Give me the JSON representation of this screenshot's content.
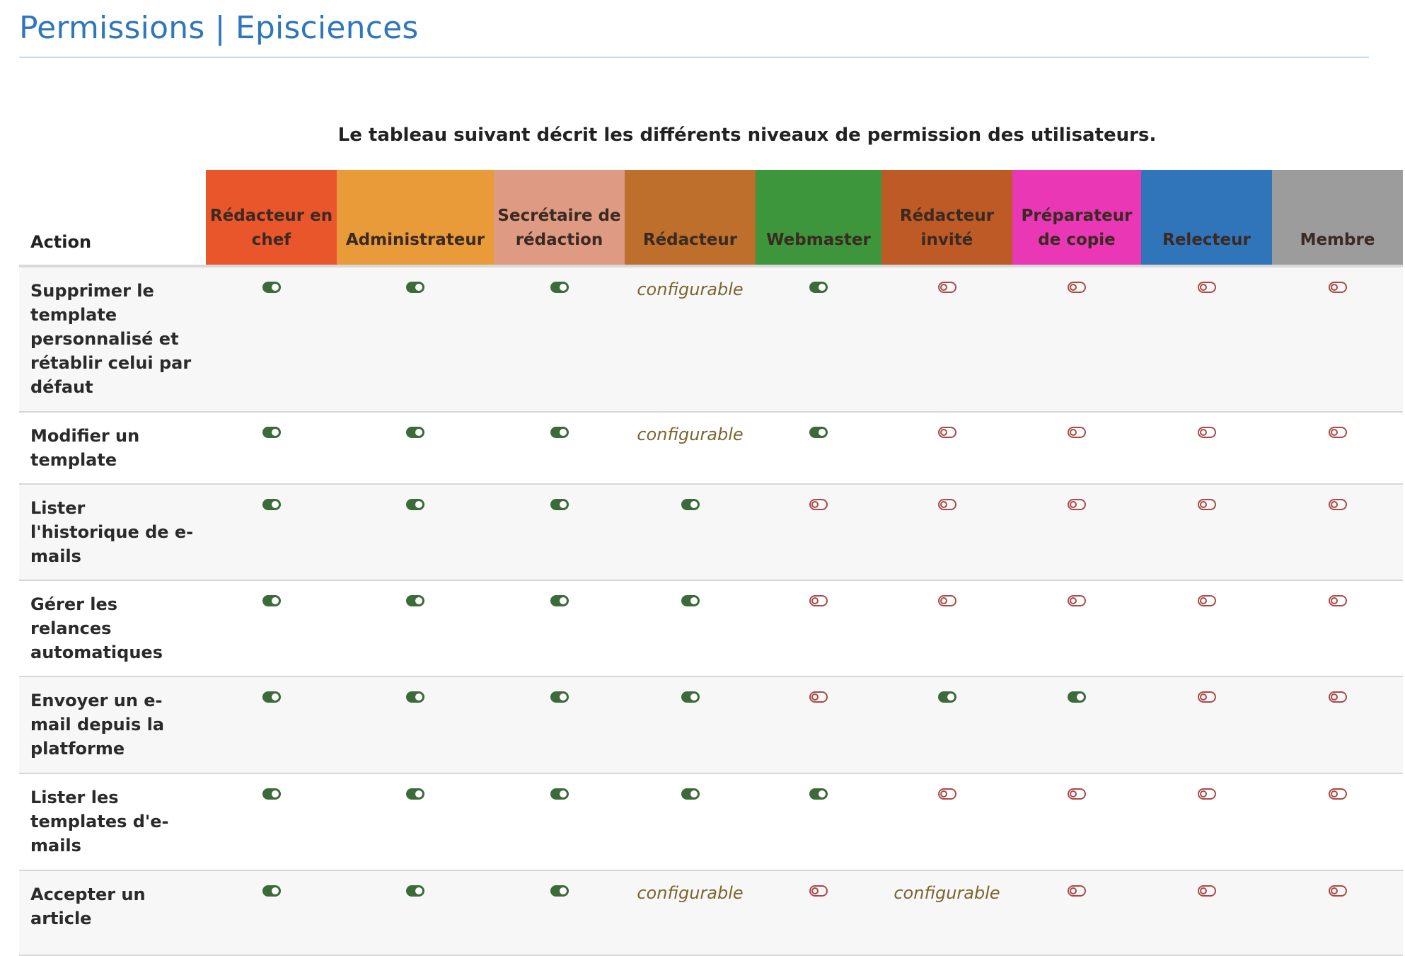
{
  "page_title": "Permissions | Episciences",
  "intro": "Le tableau suivant décrit les différents niveaux de permission des utilisateurs.",
  "table": {
    "action_header": "Action",
    "roles": [
      {
        "label": "Rédacteur en chef",
        "color": "#ea562c"
      },
      {
        "label": "Administrateur",
        "color": "#e99a39"
      },
      {
        "label": "Secrétaire de rédaction",
        "color": "#de9a82"
      },
      {
        "label": "Rédacteur",
        "color": "#bd6f2b"
      },
      {
        "label": "Webmaster",
        "color": "#3d963c"
      },
      {
        "label": "Rédacteur invité",
        "color": "#be5a25"
      },
      {
        "label": "Préparateur de copie",
        "color": "#e937b5"
      },
      {
        "label": "Relecteur",
        "color": "#3074ba"
      },
      {
        "label": "Membre",
        "color": "#9c9c9c"
      }
    ],
    "status_legend": {
      "on": "toggle-on-icon",
      "off": "toggle-off-icon",
      "configurable": "configurable"
    },
    "rows": [
      {
        "action": "Supprimer le template personnalisé et rétablir celui par défaut",
        "cells": [
          "on",
          "on",
          "on",
          "configurable",
          "on",
          "off",
          "off",
          "off",
          "off"
        ]
      },
      {
        "action": "Modifier un template",
        "cells": [
          "on",
          "on",
          "on",
          "configurable",
          "on",
          "off",
          "off",
          "off",
          "off"
        ]
      },
      {
        "action": "Lister l'historique de e-mails",
        "cells": [
          "on",
          "on",
          "on",
          "on",
          "off",
          "off",
          "off",
          "off",
          "off"
        ]
      },
      {
        "action": "Gérer les relances automatiques",
        "cells": [
          "on",
          "on",
          "on",
          "on",
          "off",
          "off",
          "off",
          "off",
          "off"
        ]
      },
      {
        "action": "Envoyer un e-mail depuis la platforme",
        "cells": [
          "on",
          "on",
          "on",
          "on",
          "off",
          "on",
          "on",
          "off",
          "off"
        ]
      },
      {
        "action": "Lister les templates d'e-mails",
        "cells": [
          "on",
          "on",
          "on",
          "on",
          "on",
          "off",
          "off",
          "off",
          "off"
        ]
      },
      {
        "action": "Accepter un article",
        "cells": [
          "on",
          "on",
          "on",
          "configurable",
          "off",
          "configurable",
          "off",
          "off",
          "off"
        ]
      }
    ],
    "colors": {
      "on": "#3c6b3a",
      "off": "#a84a48",
      "configurable_text": "#7a6530"
    }
  }
}
